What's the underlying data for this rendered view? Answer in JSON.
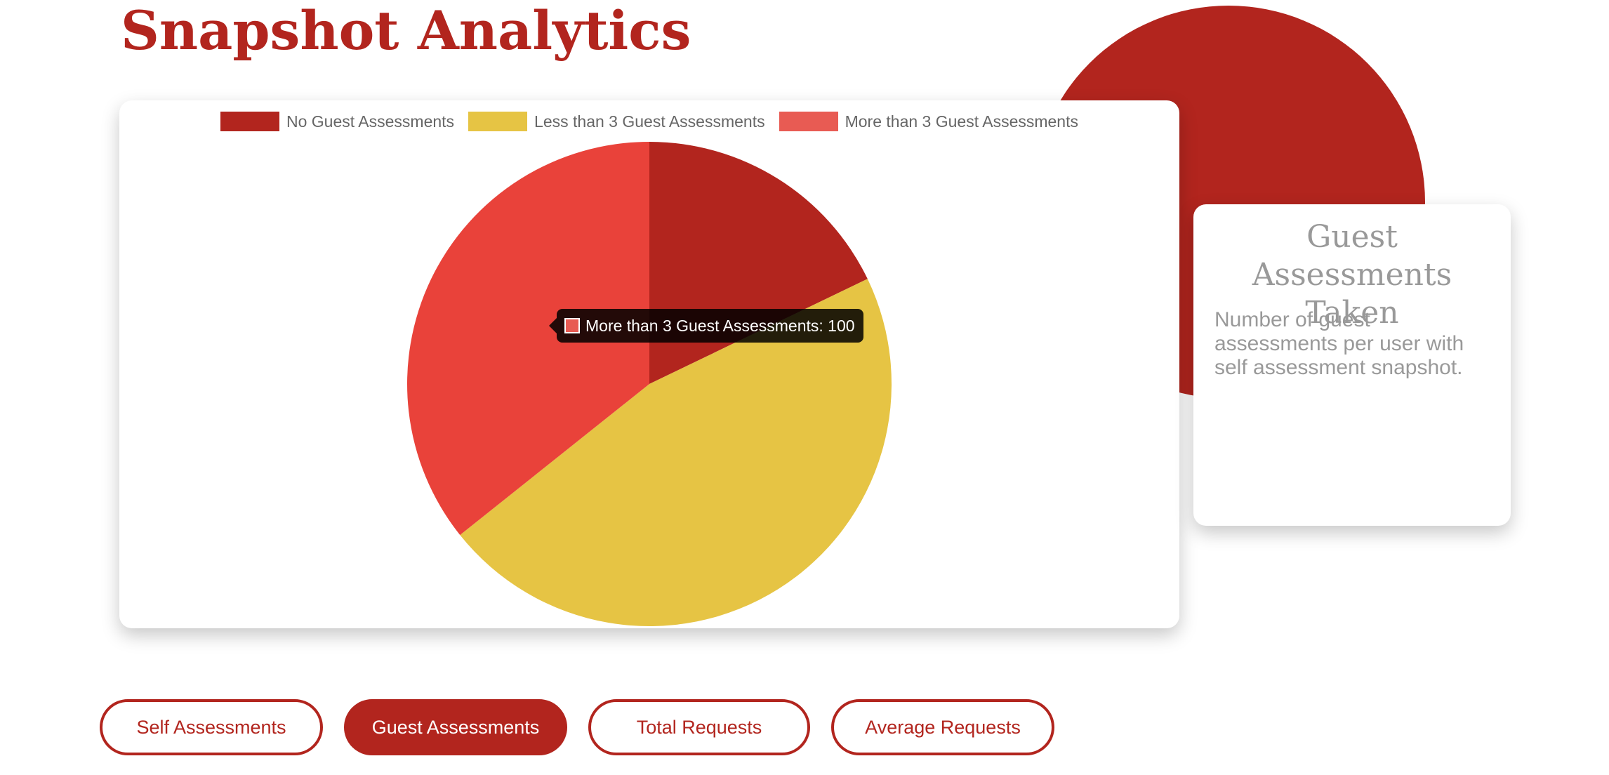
{
  "page": {
    "title": "Snapshot Analytics"
  },
  "colors": {
    "brand": "#b2251e",
    "muted_text": "#999999",
    "legend_text": "#666666"
  },
  "chart_data": {
    "type": "pie",
    "series": [
      {
        "name": "No Guest Assessments",
        "value": 50,
        "color": "#b2251e",
        "legend_color": "#b2251e"
      },
      {
        "name": "Less than 3 Guest Assessments",
        "value": 130,
        "color": "#e6c444",
        "legend_color": "#e6c444"
      },
      {
        "name": "More than 3 Guest Assessments",
        "value": 100,
        "color": "#e9423a",
        "legend_color": "#e85b53"
      }
    ],
    "legend_position": "top",
    "tooltip": {
      "text": "More than 3 Guest Assessments: 100",
      "swatch_color": "#e85b53"
    }
  },
  "info_card": {
    "title": "Guest Assessments Taken",
    "description": "Number of guest assessments per user with self assessment snapshot."
  },
  "tabs": [
    {
      "label": "Self Assessments",
      "active": false
    },
    {
      "label": "Guest Assessments",
      "active": true
    },
    {
      "label": "Total Requests",
      "active": false
    },
    {
      "label": "Average Requests",
      "active": false
    }
  ]
}
